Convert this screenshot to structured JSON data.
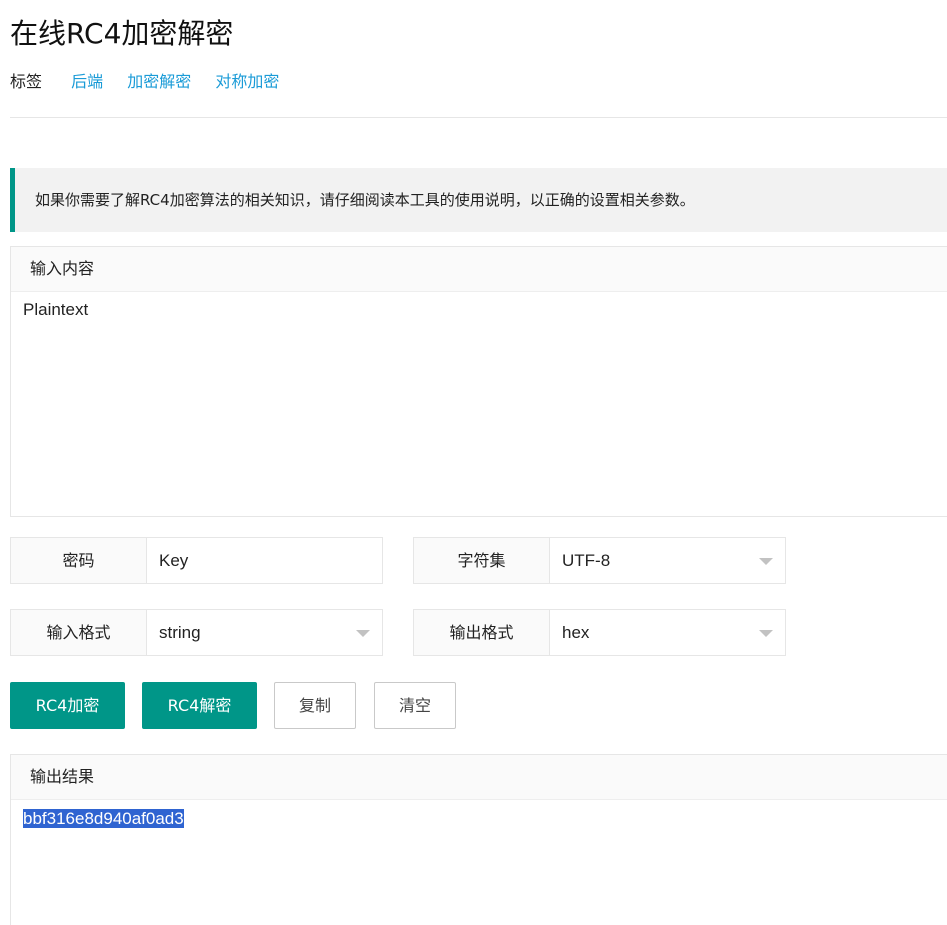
{
  "page": {
    "title": "在线RC4加密解密"
  },
  "tags": {
    "label": "标签",
    "items": [
      "后端",
      "加密解密",
      "对称加密"
    ]
  },
  "notice": {
    "text": "如果你需要了解RC4加密算法的相关知识，请仔细阅读本工具的使用说明，以正确的设置相关参数。"
  },
  "input_panel": {
    "header": "输入内容",
    "value": "Plaintext"
  },
  "options": {
    "password": {
      "label": "密码",
      "value": "Key"
    },
    "charset": {
      "label": "字符集",
      "value": "UTF-8"
    },
    "input_format": {
      "label": "输入格式",
      "value": "string"
    },
    "output_format": {
      "label": "输出格式",
      "value": "hex"
    }
  },
  "buttons": {
    "encrypt": "RC4加密",
    "decrypt": "RC4解密",
    "copy": "复制",
    "clear": "清空"
  },
  "output_panel": {
    "header": "输出结果",
    "value": "bbf316e8d940af0ad3"
  },
  "colors": {
    "accent": "#009688",
    "link": "#1a9bd7",
    "selection": "#2f64d1"
  }
}
